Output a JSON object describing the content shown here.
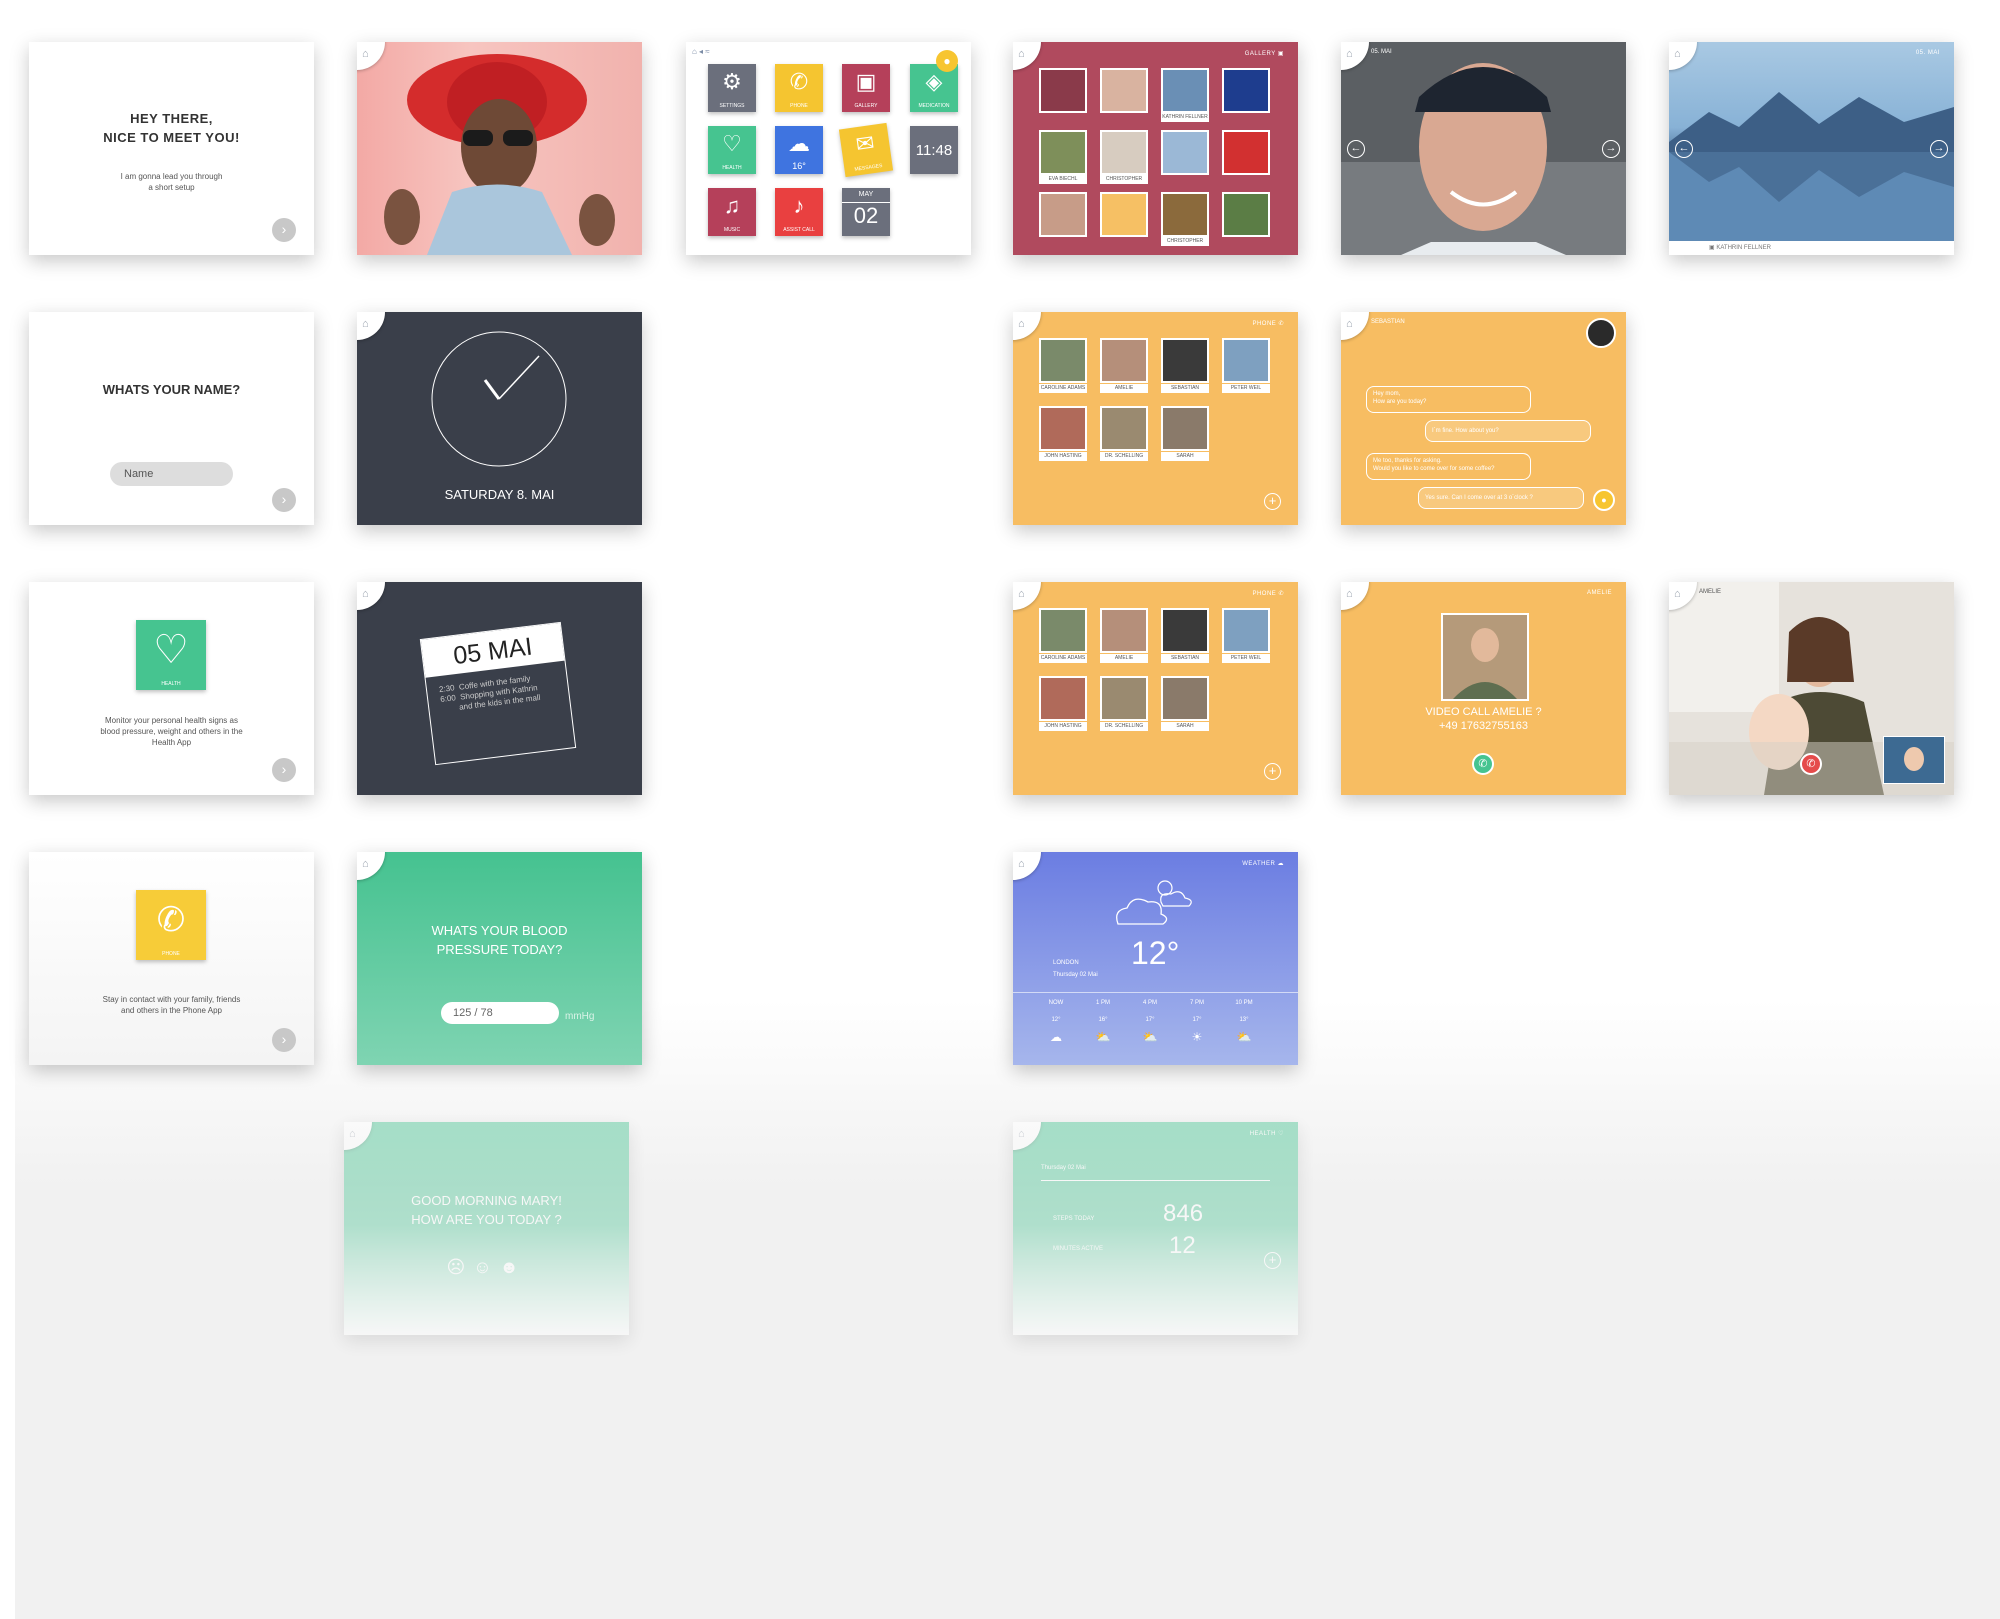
{
  "onboarding": {
    "greeting_line1": "HEY THERE,",
    "greeting_line2": "NICE TO MEET YOU!",
    "greeting_sub1": "I am gonna lead you through",
    "greeting_sub2": "a short setup",
    "name_question": "WHATS YOUR NAME?",
    "name_placeholder": "Name",
    "health_tile": "HEALTH",
    "health_text1": "Monitor your personal health signs as",
    "health_text2": "blood pressure, weight and others in the",
    "health_text3": "Health App",
    "phone_tile": "PHONE",
    "phone_text1": "Stay in contact with your family, friends",
    "phone_text2": "and others in the Phone App",
    "next_icon": "chevron-right-icon"
  },
  "clock": {
    "date_label": "SATURDAY  8. MAI"
  },
  "calendar": {
    "date": "05 MAI",
    "event1_time": "2:30",
    "event1_text": "Coffe with the family",
    "event2_time": "6:00",
    "event2_text1": "Shopping with Kathrin",
    "event2_text2": "and the kids in the mall"
  },
  "blood_pressure": {
    "question_line1": "WHATS YOUR BLOOD",
    "question_line2": "PRESSURE TODAY?",
    "value": "125 / 78",
    "unit": "mmHg"
  },
  "mood": {
    "line1": "GOOD MORNING MARY!",
    "line2": "HOW ARE YOU TODAY ?"
  },
  "home_menu": {
    "tiles": [
      {
        "label": "SETTINGS",
        "icon": "gear-icon",
        "color": "#6b6f7c"
      },
      {
        "label": "PHONE",
        "icon": "phone-icon",
        "color": "#f5c530"
      },
      {
        "label": "GALLERY",
        "icon": "image-icon",
        "color": "#b5405a"
      },
      {
        "label": "MEDICATION",
        "icon": "pill-icon",
        "color": "#46c490"
      },
      {
        "label": "HEALTH",
        "icon": "heart-icon",
        "color": "#46c490"
      },
      {
        "label": "16°",
        "icon": "weather-icon",
        "color": "#3f74e0"
      },
      {
        "label": "MESSAGES",
        "icon": "mail-icon",
        "color": "#f5c530"
      },
      {
        "label": "11:48",
        "icon": "clock-icon",
        "color": "#6b6f7c"
      },
      {
        "label": "MUSIC",
        "icon": "music-icon",
        "color": "#b5405a"
      },
      {
        "label": "ASSIST CALL",
        "icon": "bell-icon",
        "color": "#e94040"
      },
      {
        "label": "02",
        "icon": "calendar-icon",
        "color": "#6b6f7c"
      }
    ],
    "calendar_month": "MAY",
    "mic_icon": "microphone-icon"
  },
  "gallery": {
    "title": "GALLERY",
    "captions": [
      "KATHRIN FELLNER",
      "EVA BIECHL",
      "CHRISTOPHER",
      "CHRISTOPHER"
    ]
  },
  "photo_view": {
    "date": "05. MAI",
    "date2": "05. MAI",
    "caption": "KATHRIN FELLNER"
  },
  "phone": {
    "title": "PHONE",
    "contacts": [
      "CAROLINE ADAMS",
      "AMELIE",
      "SEBASTIAN",
      "PETER WEIL",
      "JOHN HASTING",
      "DR. SCHELLING",
      "SARAH"
    ]
  },
  "chat": {
    "contact": "SEBASTIAN",
    "msg1_line1": "Hey mom,",
    "msg1_line2": "How are you today?",
    "msg2": "I´m fine. How about you?",
    "msg3_line1": "Me too, thanks for asking.",
    "msg3_line2": "Would you like to come over for some coffee?",
    "msg4": "Yes sure. Can I come over at 3 o´clock ?"
  },
  "call": {
    "contact": "AMELIE",
    "question": "VIDEO CALL AMELIE ?",
    "number": "+49 17632755163",
    "video_title": "AMELIE"
  },
  "weather": {
    "title": "WEATHER",
    "city": "LONDON",
    "date": "Thursday  02 Mai",
    "temp": "12°",
    "hours": [
      "NOW",
      "1 PM",
      "4 PM",
      "7 PM",
      "10 PM"
    ],
    "temps": [
      "12°",
      "16°",
      "17°",
      "17°",
      "13°"
    ]
  },
  "health": {
    "title": "HEALTH",
    "date": "Thursday  02 Mai",
    "steps_label": "STEPS TODAY",
    "steps_value": "846",
    "second_label": "MINUTES ACTIVE",
    "second_value": "12"
  }
}
